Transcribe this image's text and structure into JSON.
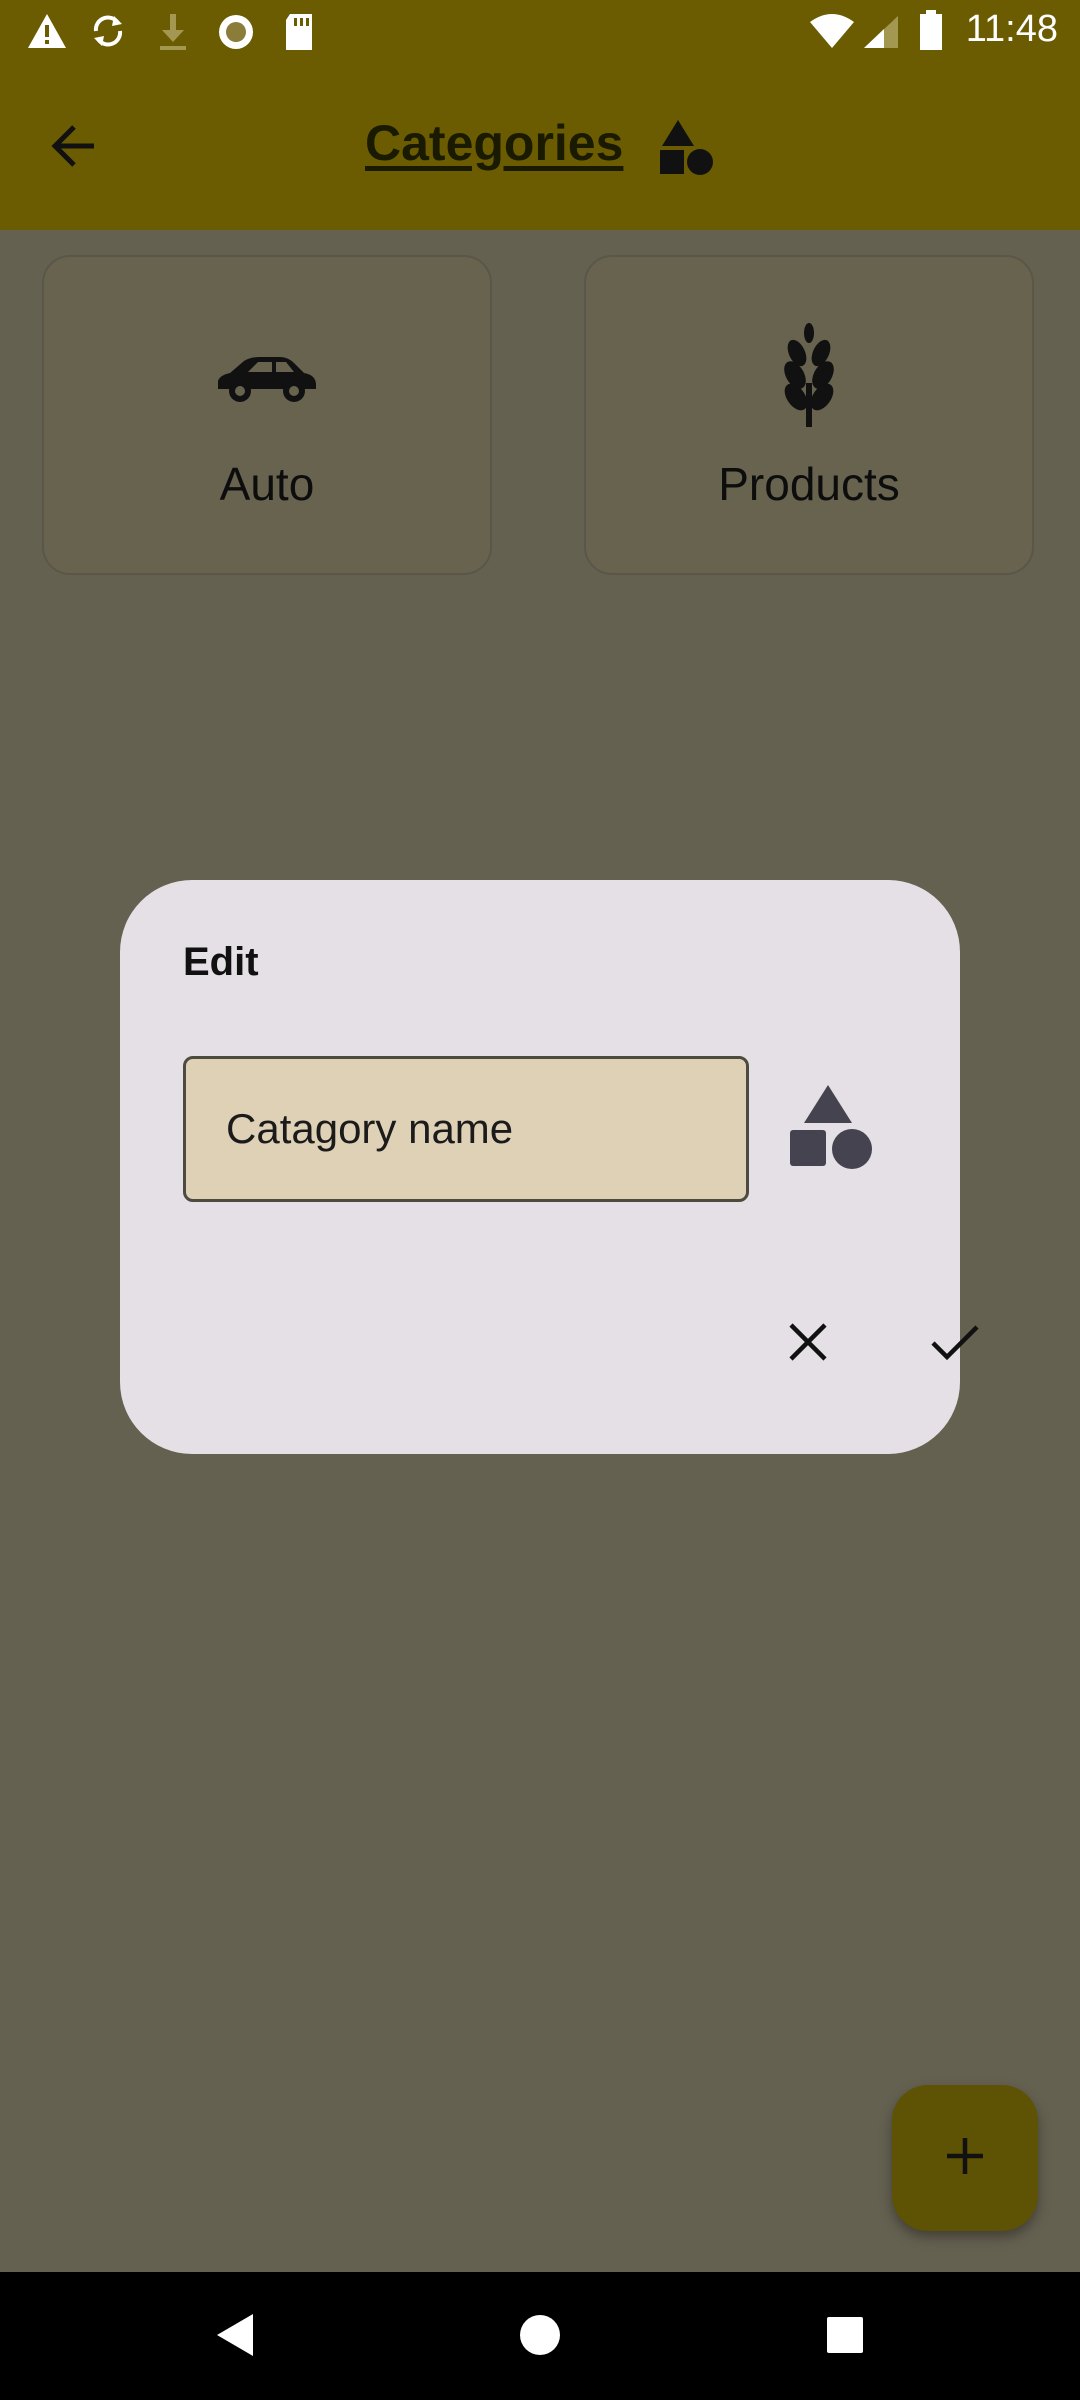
{
  "status_bar": {
    "time": "11:48",
    "left_icons": [
      "warning-icon",
      "sync-icon",
      "download-icon",
      "record-icon",
      "sd-card-icon"
    ],
    "right_icons": [
      "wifi-icon",
      "signal-icon",
      "battery-icon"
    ]
  },
  "app_bar": {
    "title": "Categories",
    "back_icon": "arrow-back-icon",
    "title_icon": "shapes-icon",
    "background": "#6b5c02"
  },
  "categories": [
    {
      "label": "Auto",
      "icon": "car-icon"
    },
    {
      "label": "Products",
      "icon": "wheat-icon"
    }
  ],
  "dialog": {
    "title": "Edit",
    "name_input": {
      "placeholder": "Catagory name",
      "value": ""
    },
    "icon_picker_icon": "shapes-icon",
    "cancel_icon": "close-icon",
    "confirm_icon": "check-icon"
  },
  "fab": {
    "icon": "plus-icon"
  },
  "nav_bar": {
    "buttons": [
      "back-triangle-icon",
      "home-circle-icon",
      "recents-square-icon"
    ]
  },
  "colors": {
    "scrim_background": "#656151",
    "dialog_background": "#e4e0e5",
    "input_background": "#dfd1b6",
    "fab_background": "#5e5204"
  }
}
